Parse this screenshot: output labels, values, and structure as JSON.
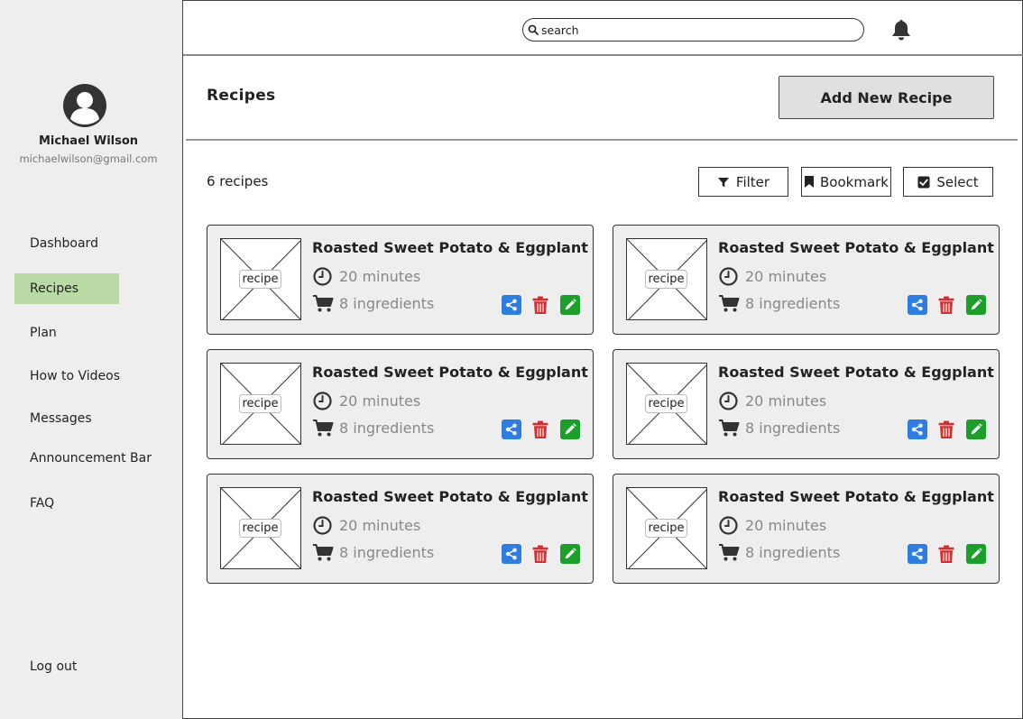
{
  "sidebar": {
    "user": {
      "name": "Michael Wilson",
      "email": "michaelwilson@gmail.com"
    },
    "items": [
      {
        "label": "Dashboard"
      },
      {
        "label": "Recipes",
        "active": true
      },
      {
        "label": "Plan"
      },
      {
        "label": "How to Videos"
      },
      {
        "label": "Messages"
      },
      {
        "label": "Announcement Bar"
      },
      {
        "label": "FAQ"
      }
    ],
    "logout_label": "Log out",
    "active_color": "#b9d9a5"
  },
  "topbar": {
    "search_placeholder": "search",
    "icons": [
      "search-icon",
      "bell-icon"
    ]
  },
  "header": {
    "title": "Recipes",
    "add_button_label": "Add New Recipe"
  },
  "toolbar": {
    "count_label": "6 recipes",
    "filter_label": "Filter",
    "bookmark_label": "Bookmark",
    "select_label": "Select"
  },
  "recipes": [
    {
      "image_label": "recipe",
      "title": "Roasted Sweet Potato & Eggplant",
      "time": "20 minutes",
      "ingredients": "8 ingredients"
    },
    {
      "image_label": "recipe",
      "title": "Roasted Sweet Potato & Eggplant",
      "time": "20 minutes",
      "ingredients": "8 ingredients"
    },
    {
      "image_label": "recipe",
      "title": "Roasted Sweet Potato & Eggplant",
      "time": "20 minutes",
      "ingredients": "8 ingredients"
    },
    {
      "image_label": "recipe",
      "title": "Roasted Sweet Potato & Eggplant",
      "time": "20 minutes",
      "ingredients": "8 ingredients"
    },
    {
      "image_label": "recipe",
      "title": "Roasted Sweet Potato & Eggplant",
      "time": "20 minutes",
      "ingredients": "8 ingredients"
    },
    {
      "image_label": "recipe",
      "title": "Roasted Sweet Potato & Eggplant",
      "time": "20 minutes",
      "ingredients": "8 ingredients"
    }
  ],
  "colors": {
    "share": "#2f7de1",
    "delete": "#d32f2f",
    "edit": "#1c9e2b"
  }
}
